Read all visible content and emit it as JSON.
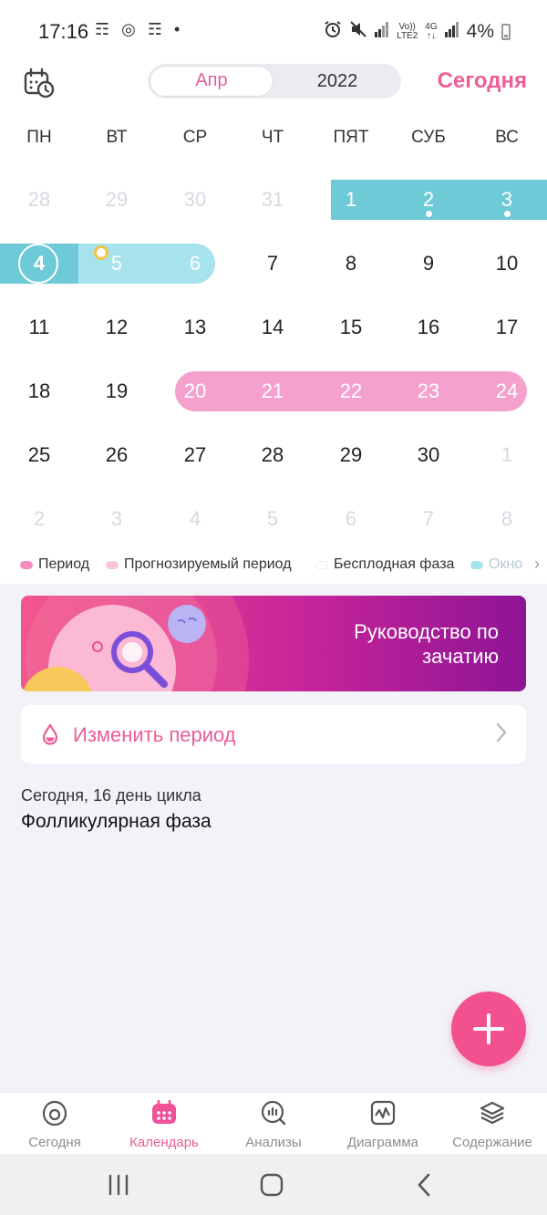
{
  "status_bar": {
    "time": "17:16",
    "left_icons": "☶ ◎ ☶ •",
    "volte_top": "Vo))",
    "volte_bottom": "LTE2",
    "net_top": "4G",
    "net_bottom": "↑↓",
    "battery": "4%"
  },
  "header": {
    "month": "Апр",
    "year": "2022",
    "today_button": "Сегодня"
  },
  "calendar": {
    "weekdays": [
      "ПН",
      "ВТ",
      "СР",
      "ЧТ",
      "ПЯТ",
      "СУБ",
      "ВС"
    ],
    "weeks": [
      [
        "28",
        "29",
        "30",
        "31",
        "1",
        "2",
        "3"
      ],
      [
        "4",
        "5",
        "6",
        "7",
        "8",
        "9",
        "10"
      ],
      [
        "11",
        "12",
        "13",
        "14",
        "15",
        "16",
        "17"
      ],
      [
        "18",
        "19",
        "20",
        "21",
        "22",
        "23",
        "24"
      ],
      [
        "25",
        "26",
        "27",
        "28",
        "29",
        "30",
        "1"
      ],
      [
        "2",
        "3",
        "4",
        "5",
        "6",
        "7",
        "8"
      ]
    ]
  },
  "legend": {
    "items": [
      {
        "label": "Период",
        "color": "#f48cbf"
      },
      {
        "label": "Прогнозируемый период",
        "color": "#f9c6de"
      },
      {
        "label": "Бесплодная фаза",
        "color": "#ffffff"
      },
      {
        "label": "Окно",
        "color": "#a7e3ec"
      }
    ]
  },
  "banner": {
    "text": "Руководство по зачатию"
  },
  "edit_period": {
    "label": "Изменить период"
  },
  "cycle": {
    "info": "Сегодня, 16 день цикла",
    "phase": "Фолликулярная фаза"
  },
  "nav": {
    "items": [
      {
        "label": "Сегодня"
      },
      {
        "label": "Календарь"
      },
      {
        "label": "Анализы"
      },
      {
        "label": "Диаграмма"
      },
      {
        "label": "Содержание"
      }
    ]
  },
  "colors": {
    "accent": "#ef5e95",
    "period_band": "#f4a2cd",
    "fertile_band": "#6fcad7",
    "fertile_light": "#a7e3ec"
  }
}
